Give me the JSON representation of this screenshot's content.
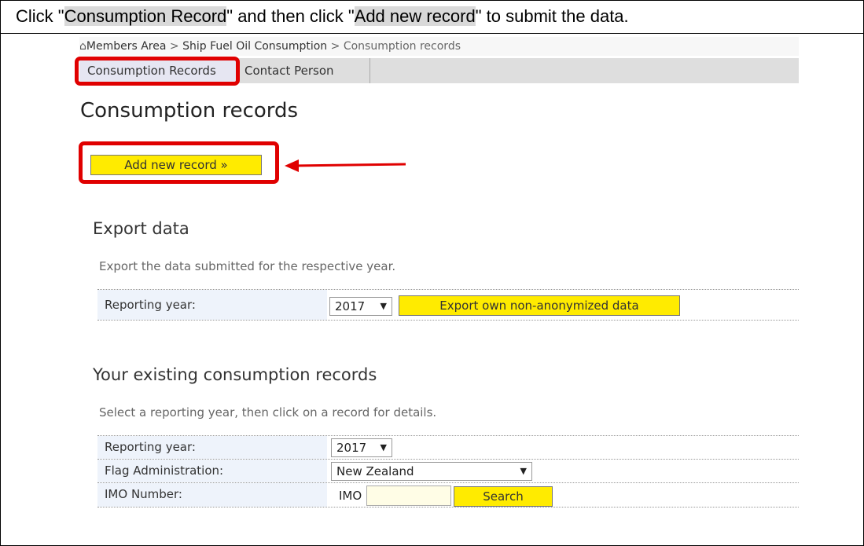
{
  "instruction": {
    "pre": "Click \"",
    "hl1": "Consumption Record",
    "mid": "\" and then click \"",
    "hl2": "Add new record",
    "post": "\" to submit the data."
  },
  "breadcrumb": {
    "home_icon": "home-icon",
    "items": [
      "Members Area",
      "Ship Fuel Oil Consumption",
      "Consumption records"
    ],
    "separator": " > "
  },
  "tabs": [
    {
      "label": "Consumption Records",
      "active": true
    },
    {
      "label": "Contact Person",
      "active": false
    }
  ],
  "page_title": "Consumption records",
  "add_button": "Add new record »",
  "export": {
    "title": "Export data",
    "description": "Export the data submitted for the respective year.",
    "year_label": "Reporting year:",
    "year_value": "2017",
    "button": "Export own non-anonymized data"
  },
  "records": {
    "title": "Your existing consumption records",
    "description": "Select a reporting year, then click on a record for details.",
    "year_label": "Reporting year:",
    "year_value": "2017",
    "flag_label": "Flag Administration:",
    "flag_value": "New Zealand",
    "imo_label": "IMO Number:",
    "imo_prefix": "IMO",
    "imo_value": "",
    "search_button": "Search"
  },
  "colors": {
    "highlight_box": "#e00000",
    "button_yellow": "#ffeb00",
    "label_bg": "#eef3fb"
  }
}
